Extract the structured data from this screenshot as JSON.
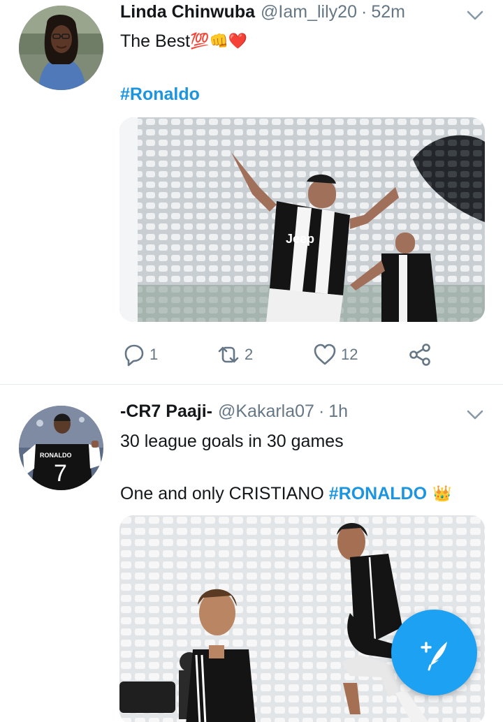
{
  "tweets": [
    {
      "name": "Linda Chinwuba",
      "handle": "@Iam_lily20",
      "separator": "·",
      "time": "52m",
      "line1": "The Best",
      "emoji_hundred": "💯",
      "emoji_fist": "👊",
      "emoji_heart": "❤️",
      "hashtag": "#Ronaldo",
      "actions": {
        "replies": "1",
        "retweets": "2",
        "likes": "12"
      },
      "avatar_icon": "woman-avatar-icon",
      "media_description_icon": "football-celebration-photo"
    },
    {
      "name": "-CR7 Paaji-",
      "handle": "@Kakarla07",
      "separator": "·",
      "time": "1h",
      "line1": "30 league goals in 30 games",
      "line2_prefix": "One and only CRISTIANO ",
      "hashtag": "#RONALDO",
      "emoji_crown": "👑",
      "avatar_jersey_name": "RONALDO",
      "avatar_jersey_number": "7",
      "jersey_sponsor": "Jeep"
    }
  ],
  "colors": {
    "link_blue": "#1b95e0",
    "fab_blue": "#1da1f2",
    "muted": "#657786",
    "text": "#14171a",
    "divider": "#e6ecf0"
  }
}
